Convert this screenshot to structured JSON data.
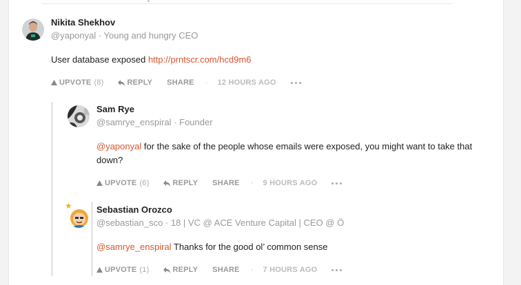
{
  "comments": [
    {
      "name": "Nikita Shekhov",
      "handle": "@yaponyal · Young and hungry CEO",
      "text": "User database exposed ",
      "link": "http://prntscr.com/hcd9m6",
      "upvote": "UPVOTE",
      "upvote_count": "(8)",
      "reply": "REPLY",
      "share": "SHARE",
      "time": "12 HOURS AGO",
      "avatar_icon": "person-avatar-icon"
    },
    {
      "name": "Sam Rye",
      "handle": "@samrye_enspiral · Founder",
      "mention": "@yaponyal",
      "text": " for the sake of the people whose emails were exposed, you might want to take that down?",
      "upvote": "UPVOTE",
      "upvote_count": "(6)",
      "reply": "REPLY",
      "share": "SHARE",
      "time": "9 HOURS AGO",
      "avatar_icon": "bw-photo-avatar-icon"
    },
    {
      "name": "Sebastian Orozco",
      "handle": "@sebastian_sco · 18 | VC @ ACE Venture Capital | CEO @ Ö",
      "mention": "@samrye_enspiral",
      "text": " Thanks for the good ol’ common sense",
      "upvote": "UPVOTE",
      "upvote_count": "(1)",
      "reply": "REPLY",
      "share": "SHARE",
      "time": "7 HOURS AGO",
      "avatar_icon": "cartoon-avatar-icon"
    }
  ],
  "colors": {
    "accent": "#da552f",
    "muted": "#999999",
    "text": "#222222"
  },
  "separator": "·"
}
